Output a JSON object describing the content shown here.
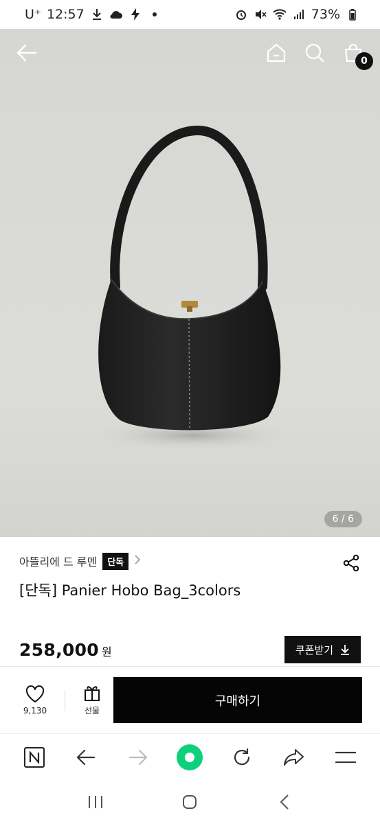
{
  "status_bar": {
    "carrier": "U⁺",
    "time": "12:57",
    "battery": "73%"
  },
  "gallery": {
    "pager": "6 / 6"
  },
  "header": {
    "cart_count": "0"
  },
  "product": {
    "brand": "아뜰리에 드 루멘",
    "exclusive_badge": "단독",
    "title": "[단독] Panier Hobo Bag_3colors",
    "price": "258,000",
    "currency": "원",
    "coupon_label": "쿠폰받기"
  },
  "actions": {
    "like_count": "9,130",
    "gift_label": "선물",
    "buy_label": "구매하기"
  },
  "colors": {
    "primary": "#111111",
    "browser_green": "#0bd27a"
  }
}
